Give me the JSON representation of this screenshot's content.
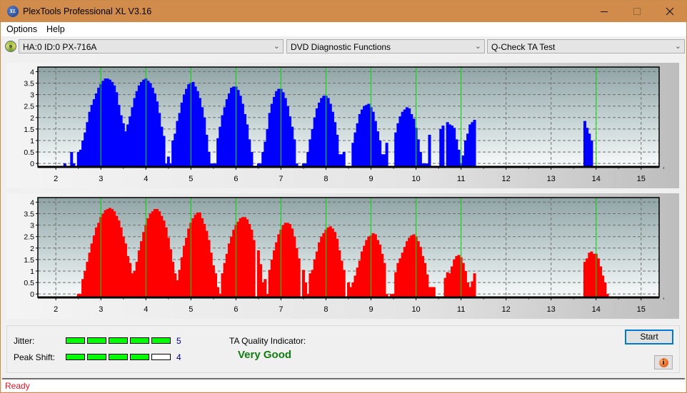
{
  "window": {
    "title": "PlexTools Professional XL V3.16",
    "app_icon": "xl-logo-icon",
    "controls": [
      "minimize-icon",
      "maximize-icon",
      "close-icon"
    ]
  },
  "menu": {
    "items": [
      {
        "label": "Options"
      },
      {
        "label": "Help"
      }
    ]
  },
  "toolbar": {
    "drive_icon": "disc-icon",
    "drive_select": "HA:0 ID:0  PX-716A",
    "function_select": "DVD Diagnostic Functions",
    "test_select": "Q-Check TA Test"
  },
  "colors": {
    "titlebar": "#d18c4c",
    "top_bars": "#0000ff",
    "bottom_bars": "#ff0000",
    "peak_lines": "#00e000",
    "good_segment": "#00ff00",
    "quality_text": "#107c10",
    "status_text": "#e81123"
  },
  "chart_data": [
    {
      "type": "bar",
      "name": "lands",
      "title": "",
      "xlabel": "",
      "ylabel": "",
      "xlim": [
        1.6,
        15.4
      ],
      "ylim": [
        -0.15,
        4.2
      ],
      "x_ticks": [
        "2",
        "3",
        "4",
        "5",
        "6",
        "7",
        "8",
        "9",
        "10",
        "11",
        "12",
        "13",
        "14",
        "15"
      ],
      "y_ticks": [
        "0",
        "0.5",
        "1",
        "1.5",
        "2",
        "2.5",
        "3",
        "3.5",
        "4"
      ],
      "grid": true,
      "reference_lines_x": [
        3,
        4,
        5,
        6,
        7,
        8,
        9,
        10,
        11,
        14
      ],
      "color": "#0000ff",
      "x": [
        2.2,
        2.35,
        2.4,
        2.5,
        2.55,
        2.6,
        2.65,
        2.7,
        2.75,
        2.8,
        2.85,
        2.9,
        2.95,
        3.0,
        3.05,
        3.1,
        3.15,
        3.2,
        3.25,
        3.3,
        3.35,
        3.4,
        3.45,
        3.5,
        3.55,
        3.6,
        3.65,
        3.7,
        3.75,
        3.8,
        3.85,
        3.9,
        3.95,
        4.0,
        4.05,
        4.1,
        4.15,
        4.2,
        4.25,
        4.3,
        4.35,
        4.4,
        4.45,
        4.5,
        4.55,
        4.6,
        4.65,
        4.7,
        4.75,
        4.8,
        4.85,
        4.9,
        4.95,
        5.0,
        5.05,
        5.1,
        5.15,
        5.2,
        5.25,
        5.3,
        5.35,
        5.4,
        5.45,
        5.5,
        5.55,
        5.6,
        5.65,
        5.7,
        5.75,
        5.8,
        5.85,
        5.9,
        5.95,
        6.0,
        6.05,
        6.1,
        6.15,
        6.2,
        6.25,
        6.3,
        6.35,
        6.5,
        6.55,
        6.6,
        6.65,
        6.7,
        6.75,
        6.8,
        6.85,
        6.9,
        6.95,
        7.0,
        7.05,
        7.1,
        7.15,
        7.2,
        7.25,
        7.3,
        7.35,
        7.5,
        7.55,
        7.6,
        7.65,
        7.7,
        7.75,
        7.8,
        7.85,
        7.9,
        7.95,
        8.0,
        8.05,
        8.1,
        8.15,
        8.2,
        8.25,
        8.3,
        8.35,
        8.4,
        8.6,
        8.65,
        8.7,
        8.75,
        8.8,
        8.85,
        8.9,
        8.95,
        9.0,
        9.05,
        9.1,
        9.15,
        9.2,
        9.25,
        9.3,
        9.35,
        9.55,
        9.6,
        9.65,
        9.7,
        9.75,
        9.8,
        9.85,
        9.9,
        9.95,
        10.0,
        10.05,
        10.1,
        10.15,
        10.2,
        10.25,
        10.3,
        10.55,
        10.6,
        10.7,
        10.75,
        10.8,
        10.85,
        10.9,
        10.95,
        11.0,
        11.05,
        11.1,
        11.15,
        11.2,
        11.25,
        11.3,
        13.75,
        13.8,
        13.85,
        13.9,
        13.95,
        14.0,
        14.05,
        14.1,
        14.15,
        14.2
      ],
      "values": [
        0,
        0.5,
        0,
        0.5,
        0.6,
        1,
        1.35,
        1.8,
        2.25,
        2.55,
        2.8,
        3.05,
        3.3,
        3.45,
        3.6,
        3.7,
        3.7,
        3.65,
        3.55,
        3.4,
        3.1,
        2.55,
        2.1,
        1.75,
        1.4,
        1.7,
        2.05,
        2.45,
        2.85,
        3.15,
        3.4,
        3.55,
        3.65,
        3.7,
        3.6,
        3.5,
        3.3,
        3.05,
        2.7,
        2.2,
        1.6,
        1.2,
        0,
        0.3,
        0,
        1,
        1.3,
        1.85,
        2.2,
        2.65,
        3,
        3.25,
        3.45,
        3.5,
        3.55,
        3.35,
        3.15,
        2.85,
        2.45,
        2,
        1.25,
        0.5,
        0,
        0,
        0,
        1.1,
        1.6,
        2.1,
        2.45,
        2.8,
        3.05,
        3.3,
        3.35,
        3.35,
        3.2,
        2.95,
        2.6,
        2.15,
        1.7,
        1.05,
        0.5,
        0,
        0,
        0.5,
        0.95,
        1.5,
        2.2,
        2.6,
        2.9,
        3.15,
        3.25,
        3.25,
        3.1,
        2.85,
        2.5,
        2.05,
        1.6,
        1.05,
        0,
        0,
        0,
        0.5,
        1.05,
        1.5,
        2,
        2.4,
        2.65,
        2.85,
        2.95,
        2.95,
        2.85,
        2.6,
        2.25,
        1.8,
        1.25,
        0.4,
        0.4,
        0.5,
        0.9,
        1.35,
        1.75,
        2.15,
        2.35,
        2.5,
        2.55,
        2.6,
        2.45,
        2.25,
        1.85,
        1.4,
        1,
        0.4,
        0.4,
        0.9,
        1.35,
        1.75,
        2.05,
        2.25,
        2.35,
        2.45,
        2.4,
        2.15,
        1.95,
        1.55,
        1.05,
        0.5,
        0,
        0,
        0,
        1.25,
        1.5,
        1.65,
        1.8,
        1.7,
        1.65,
        1.55,
        1.05,
        0.6,
        0,
        0.35,
        1,
        1.3,
        1.7,
        1.8,
        1.9,
        1.85,
        1.55,
        1.3,
        1
      ]
    },
    {
      "type": "bar",
      "name": "pits",
      "title": "",
      "xlabel": "",
      "ylabel": "",
      "xlim": [
        1.6,
        15.4
      ],
      "ylim": [
        -0.15,
        4.2
      ],
      "x_ticks": [
        "2",
        "3",
        "4",
        "5",
        "6",
        "7",
        "8",
        "9",
        "10",
        "11",
        "12",
        "13",
        "14",
        "15"
      ],
      "y_ticks": [
        "0",
        "0.5",
        "1",
        "1.5",
        "2",
        "2.5",
        "3",
        "3.5",
        "4"
      ],
      "grid": true,
      "reference_lines_x": [
        3,
        4,
        5,
        6,
        7,
        8,
        9,
        10,
        11,
        14
      ],
      "color": "#ff0000",
      "x": [
        2.5,
        2.55,
        2.6,
        2.65,
        2.7,
        2.75,
        2.8,
        2.85,
        2.9,
        2.95,
        3.0,
        3.05,
        3.1,
        3.15,
        3.2,
        3.25,
        3.3,
        3.35,
        3.4,
        3.45,
        3.5,
        3.55,
        3.6,
        3.65,
        3.7,
        3.75,
        3.8,
        3.85,
        3.9,
        3.95,
        4.0,
        4.05,
        4.1,
        4.15,
        4.2,
        4.25,
        4.3,
        4.35,
        4.4,
        4.45,
        4.5,
        4.55,
        4.6,
        4.65,
        4.7,
        4.75,
        4.8,
        4.85,
        4.9,
        4.95,
        5.0,
        5.05,
        5.1,
        5.15,
        5.2,
        5.25,
        5.3,
        5.35,
        5.4,
        5.45,
        5.5,
        5.55,
        5.6,
        5.65,
        5.7,
        5.75,
        5.8,
        5.85,
        5.9,
        5.95,
        6.0,
        6.05,
        6.1,
        6.15,
        6.2,
        6.25,
        6.3,
        6.35,
        6.4,
        6.5,
        6.55,
        6.6,
        6.65,
        6.7,
        6.75,
        6.8,
        6.85,
        6.9,
        6.95,
        7.0,
        7.05,
        7.1,
        7.15,
        7.2,
        7.25,
        7.3,
        7.35,
        7.4,
        7.5,
        7.55,
        7.6,
        7.65,
        7.7,
        7.75,
        7.8,
        7.85,
        7.9,
        7.95,
        8.0,
        8.05,
        8.1,
        8.15,
        8.2,
        8.25,
        8.3,
        8.35,
        8.4,
        8.5,
        8.55,
        8.6,
        8.65,
        8.7,
        8.75,
        8.8,
        8.85,
        8.9,
        8.95,
        9.0,
        9.05,
        9.1,
        9.15,
        9.2,
        9.25,
        9.3,
        9.35,
        9.45,
        9.5,
        9.55,
        9.6,
        9.65,
        9.7,
        9.75,
        9.8,
        9.85,
        9.9,
        9.95,
        10.0,
        10.05,
        10.1,
        10.15,
        10.2,
        10.25,
        10.3,
        10.35,
        10.4,
        10.65,
        10.7,
        10.75,
        10.8,
        10.85,
        10.9,
        10.95,
        11.0,
        11.05,
        11.1,
        11.15,
        11.2,
        11.25,
        11.3,
        13.75,
        13.8,
        13.85,
        13.9,
        13.95,
        14.0,
        14.05,
        14.1,
        14.15,
        14.2,
        14.25,
        14.3,
        14.45
      ],
      "values": [
        0,
        0,
        0.65,
        1,
        1.4,
        1.8,
        2.2,
        2.55,
        2.9,
        3.1,
        3.35,
        3.5,
        3.65,
        3.7,
        3.75,
        3.7,
        3.6,
        3.4,
        3.2,
        2.9,
        2.5,
        2.2,
        1.65,
        1.35,
        0.9,
        1,
        1.4,
        1.9,
        2.3,
        2.7,
        3,
        3.3,
        3.5,
        3.6,
        3.7,
        3.7,
        3.6,
        3.4,
        3.2,
        2.9,
        2.45,
        1.95,
        1.4,
        0.9,
        0.6,
        1.05,
        1.6,
        2.1,
        2.45,
        2.85,
        3.1,
        3.3,
        3.45,
        3.55,
        3.55,
        3.3,
        3.05,
        2.75,
        2.35,
        1.8,
        1.25,
        0.9,
        0.3,
        0,
        0.9,
        1.35,
        1.75,
        2.2,
        2.5,
        2.8,
        3,
        3.15,
        3.3,
        3.35,
        3.35,
        3.25,
        3.05,
        2.8,
        2.35,
        1.9,
        1.3,
        0.5,
        0.65,
        0,
        1.05,
        1.5,
        1.9,
        2.25,
        2.6,
        2.8,
        3.0,
        3.1,
        3.1,
        3.05,
        2.85,
        2.5,
        2.0,
        1.55,
        1.05,
        0.5,
        0,
        0.9,
        1.05,
        1.5,
        1.85,
        2.25,
        2.5,
        2.65,
        2.8,
        2.9,
        2.95,
        2.85,
        2.7,
        2.4,
        1.9,
        1.45,
        1.05,
        0.5,
        0.3,
        0.5,
        0.8,
        1.15,
        1.45,
        1.85,
        2.1,
        2.35,
        2.5,
        2.55,
        2.65,
        2.6,
        2.35,
        2.15,
        1.75,
        1.35,
        0,
        0,
        0,
        0.95,
        1.35,
        1.55,
        1.8,
        2.05,
        2.3,
        2.45,
        2.55,
        2.6,
        2.5,
        2.3,
        2.05,
        1.65,
        1.35,
        0.85,
        0.3,
        0.3,
        0.3,
        0.7,
        0.95,
        0.9,
        1.2,
        1.5,
        1.65,
        1.7,
        1.6,
        1.35,
        1.0,
        0.5,
        0.3,
        0.55,
        0.9,
        1.4,
        1.55,
        1.8,
        1.85,
        1.75,
        1.75,
        1.55,
        1.2,
        0.8,
        0.5,
        0
      ]
    }
  ],
  "results": {
    "jitter": {
      "label": "Jitter:",
      "value": "5",
      "score": 5,
      "max": 5
    },
    "peak_shift": {
      "label": "Peak Shift:",
      "value": "4",
      "score": 4,
      "max": 5
    },
    "ta_quality_label": "TA Quality Indicator:",
    "ta_quality_value": "Very Good"
  },
  "buttons": {
    "start": "Start",
    "info_icon": "info-icon"
  },
  "status": {
    "text": "Ready"
  }
}
